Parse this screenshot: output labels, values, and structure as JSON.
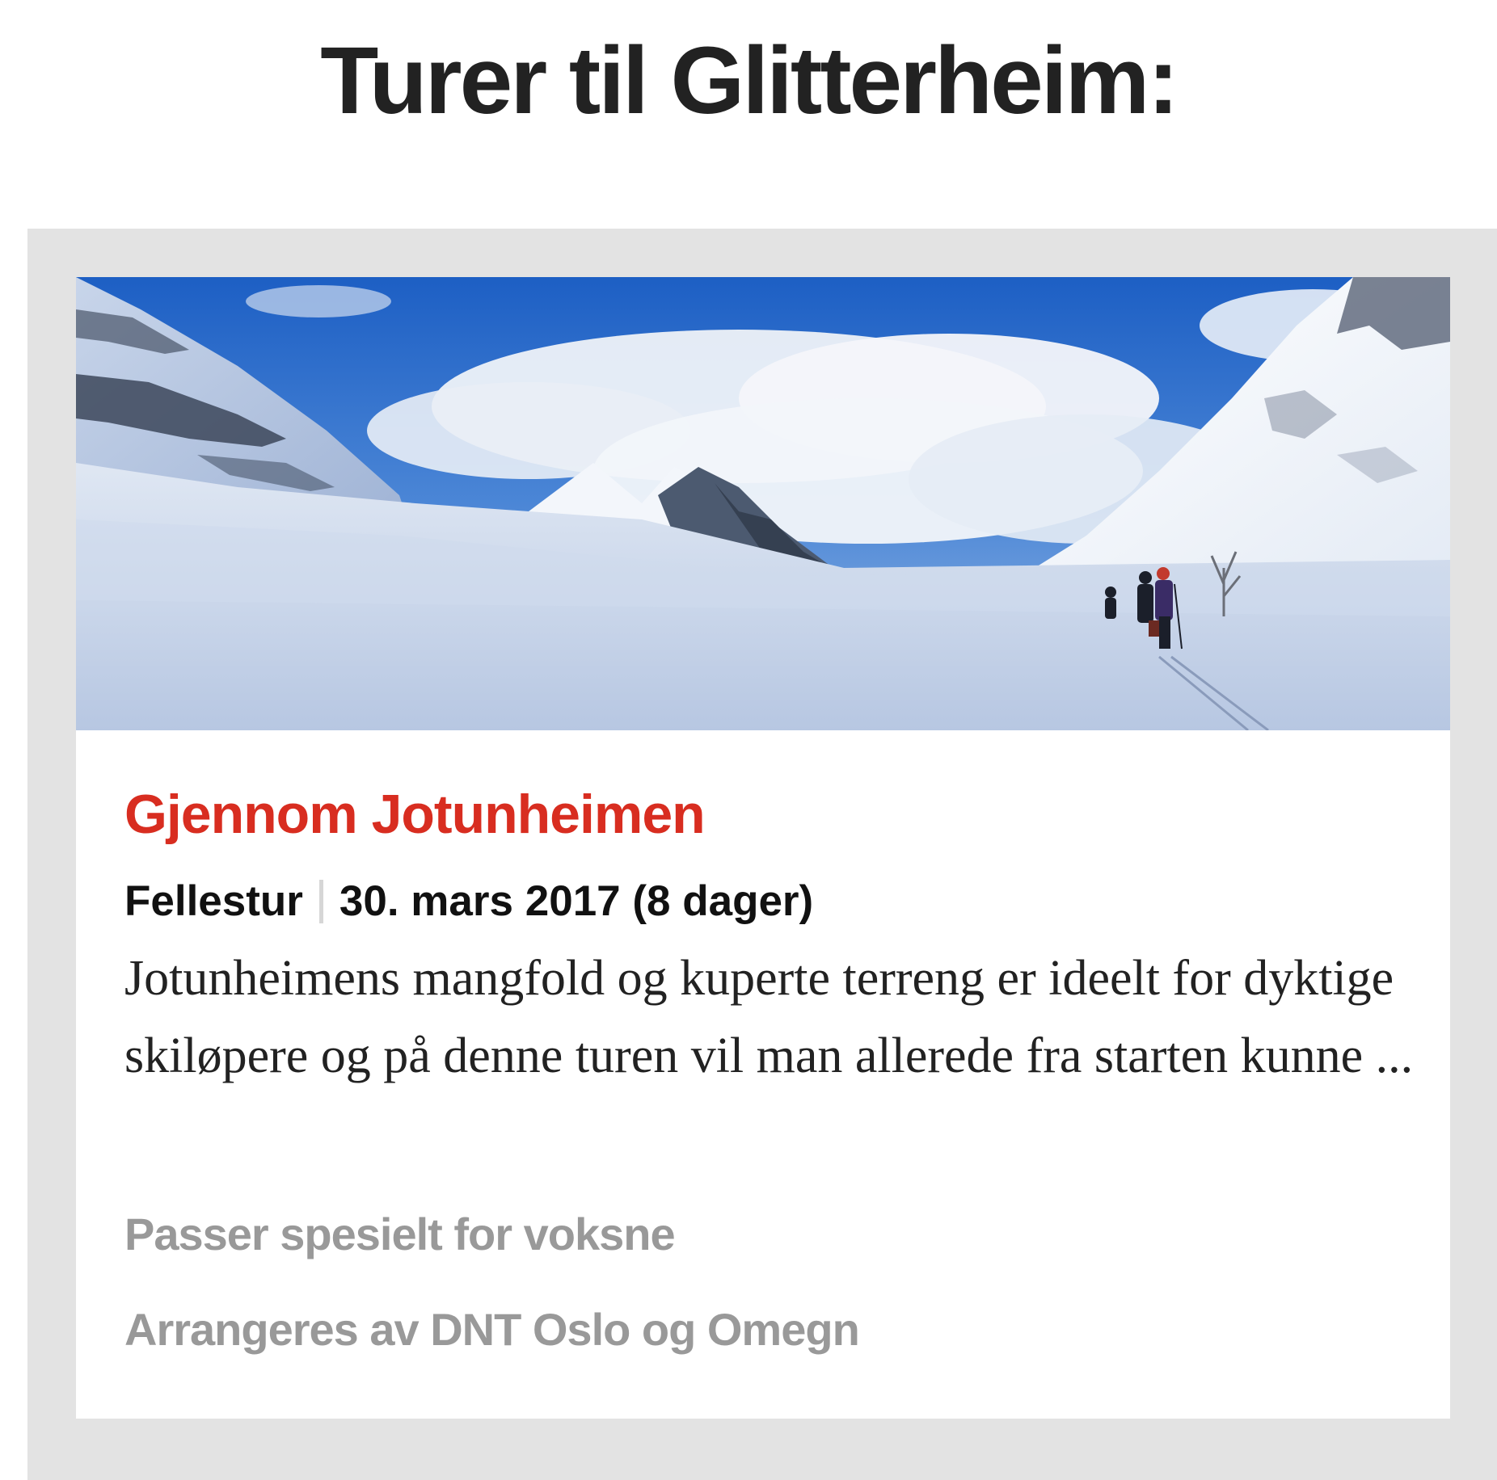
{
  "page": {
    "title": "Turer til Glitterheim:"
  },
  "trips": [
    {
      "title": "Gjennom Jotunheimen",
      "type": "Fellestur",
      "date": "30. mars 2017 (8 dager)",
      "description": "Jotunheimens mangfold og kuperte terreng er ideelt for dyktige skiløpere og på denne turen vil man allerede fra starten kunne ...",
      "audience": "Passer spesielt for voksne",
      "organizer": "Arrangeres av DNT Oslo og Omegn",
      "image": "winter-mountain-skiers-photo"
    }
  ],
  "colors": {
    "title_text": "#222222",
    "trip_title": "#d82d20",
    "meta_text": "#999999",
    "list_background": "#e3e3e3",
    "card_background": "#ffffff"
  }
}
